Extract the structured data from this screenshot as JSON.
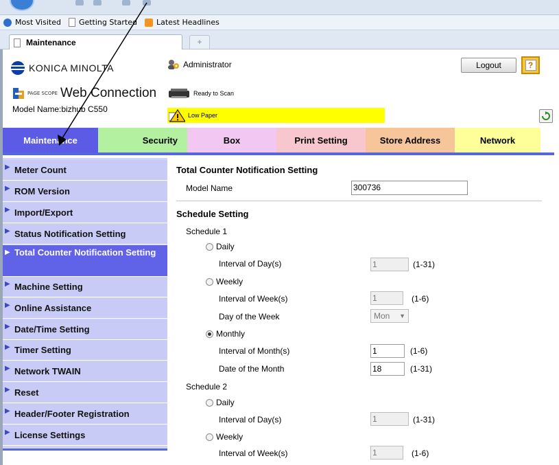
{
  "browser": {
    "bookmarks": [
      {
        "label": "Most Visited",
        "icon": "globe-icon"
      },
      {
        "label": "Getting Started",
        "icon": "page-icon"
      },
      {
        "label": "Latest Headlines",
        "icon": "rss-icon"
      }
    ],
    "tab_title": "Maintenance",
    "new_tab": "+"
  },
  "header": {
    "brand": "KONICA MINOLTA",
    "pagescope_small": "PAGE SCOPE",
    "product": "Web Connection",
    "model_label": "Model Name:bizhub C550",
    "user": "Administrator",
    "status_scan": "Ready to Scan",
    "status_warning": "Low Paper",
    "logout_label": "Logout",
    "help_label": "?"
  },
  "nav": {
    "tabs": [
      {
        "label": "Maintenance"
      },
      {
        "label": "Security"
      },
      {
        "label": "Box"
      },
      {
        "label": "Print Setting"
      },
      {
        "label": "Store Address"
      },
      {
        "label": "Network"
      }
    ]
  },
  "sidebar": {
    "items": [
      {
        "label": "Meter Count"
      },
      {
        "label": "ROM Version"
      },
      {
        "label": "Import/Export"
      },
      {
        "label": "Status Notification Setting"
      },
      {
        "label": "Total Counter Notification Setting"
      },
      {
        "label": "Machine Setting"
      },
      {
        "label": "Online Assistance"
      },
      {
        "label": "Date/Time Setting"
      },
      {
        "label": "Timer Setting"
      },
      {
        "label": "Network TWAIN"
      },
      {
        "label": "Reset"
      },
      {
        "label": "Header/Footer Registration"
      },
      {
        "label": "License Settings"
      }
    ]
  },
  "main": {
    "title": "Total Counter Notification Setting",
    "model_name_label": "Model Name",
    "model_name_value": "300736",
    "schedule_title": "Schedule Setting",
    "schedule1": {
      "label": "Schedule 1",
      "daily": "Daily",
      "interval_day_label": "Interval of Day(s)",
      "interval_day_value": "1",
      "interval_day_range": "(1-31)",
      "weekly": "Weekly",
      "interval_week_label": "Interval of Week(s)",
      "interval_week_value": "1",
      "interval_week_range": "(1-6)",
      "day_of_week_label": "Day of the Week",
      "day_of_week_value": "Mon",
      "monthly": "Monthly",
      "interval_month_label": "Interval of Month(s)",
      "interval_month_value": "1",
      "interval_month_range": "(1-6)",
      "date_month_label": "Date of the Month",
      "date_month_value": "18",
      "date_month_range": "(1-31)"
    },
    "schedule2": {
      "label": "Schedule 2",
      "daily": "Daily",
      "interval_day_label": "Interval of Day(s)",
      "interval_day_value": "1",
      "interval_day_range": "(1-31)",
      "weekly": "Weekly",
      "interval_week_label": "Interval of Week(s)",
      "interval_week_value": "1",
      "interval_week_range": "(1-6)"
    }
  }
}
